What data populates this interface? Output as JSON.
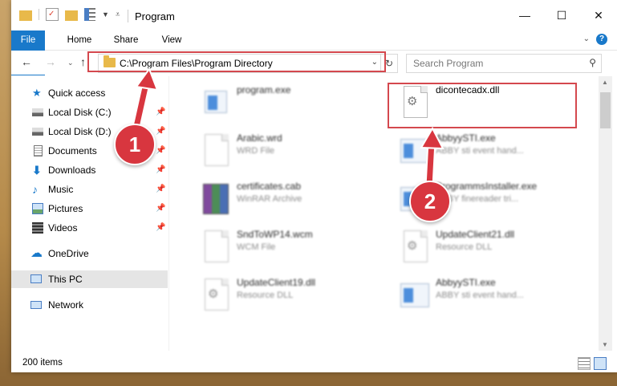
{
  "window": {
    "title": "Program",
    "controls": {
      "minimize": "—",
      "maximize": "☐",
      "close": "✕"
    }
  },
  "ribbon": {
    "tabs": [
      "File",
      "Home",
      "Share",
      "View"
    ],
    "help": "?"
  },
  "address": {
    "path": "C:\\Program Files\\Program Directory",
    "search_placeholder": "Search Program"
  },
  "nav": {
    "items": [
      {
        "label": "Quick access",
        "icon": "star-icon"
      },
      {
        "label": "Local Disk (C:)",
        "icon": "drive-icon",
        "pinned": true
      },
      {
        "label": "Local Disk (D:)",
        "icon": "drive-icon",
        "pinned": true
      },
      {
        "label": "Documents",
        "icon": "documents-icon",
        "pinned": true
      },
      {
        "label": "Downloads",
        "icon": "download-icon",
        "pinned": true
      },
      {
        "label": "Music",
        "icon": "music-icon",
        "pinned": true
      },
      {
        "label": "Pictures",
        "icon": "pictures-icon",
        "pinned": true
      },
      {
        "label": "Videos",
        "icon": "videos-icon",
        "pinned": true
      },
      {
        "label": "OneDrive",
        "icon": "cloud-icon"
      },
      {
        "label": "This PC",
        "icon": "computer-icon",
        "selected": true
      },
      {
        "label": "Network",
        "icon": "network-icon"
      }
    ]
  },
  "files": [
    {
      "name": "program.exe",
      "type": "",
      "icon": "exe-icon"
    },
    {
      "name": "dicontecadx.dll",
      "type": "",
      "icon": "dll-gear-icon"
    },
    {
      "name": "Arabic.wrd",
      "type": "WRD File",
      "icon": "document-icon"
    },
    {
      "name": "AbbyySTI.exe",
      "type": "ABBY sti event hand...",
      "icon": "exe-icon"
    },
    {
      "name": "certificates.cab",
      "type": "WinRAR Archive",
      "icon": "winrar-icon"
    },
    {
      "name": "ProgrammsInstaller.exe",
      "type": "ABBY finereader tri...",
      "icon": "exe-icon"
    },
    {
      "name": "SndToWP14.wcm",
      "type": "WCM File",
      "icon": "document-icon"
    },
    {
      "name": "UpdateClient21.dll",
      "type": "Resource DLL",
      "icon": "dll-gear-icon"
    },
    {
      "name": "UpdateClient19.dll",
      "type": "Resource DLL",
      "icon": "dll-gear-icon"
    },
    {
      "name": "AbbyySTI.exe",
      "type": "ABBY sti event hand...",
      "icon": "exe-icon"
    }
  ],
  "status": {
    "count": "200 items"
  },
  "callouts": [
    "1",
    "2"
  ],
  "colors": {
    "accent": "#1979ca",
    "highlight": "#d4484e",
    "callout": "#d8363f"
  }
}
